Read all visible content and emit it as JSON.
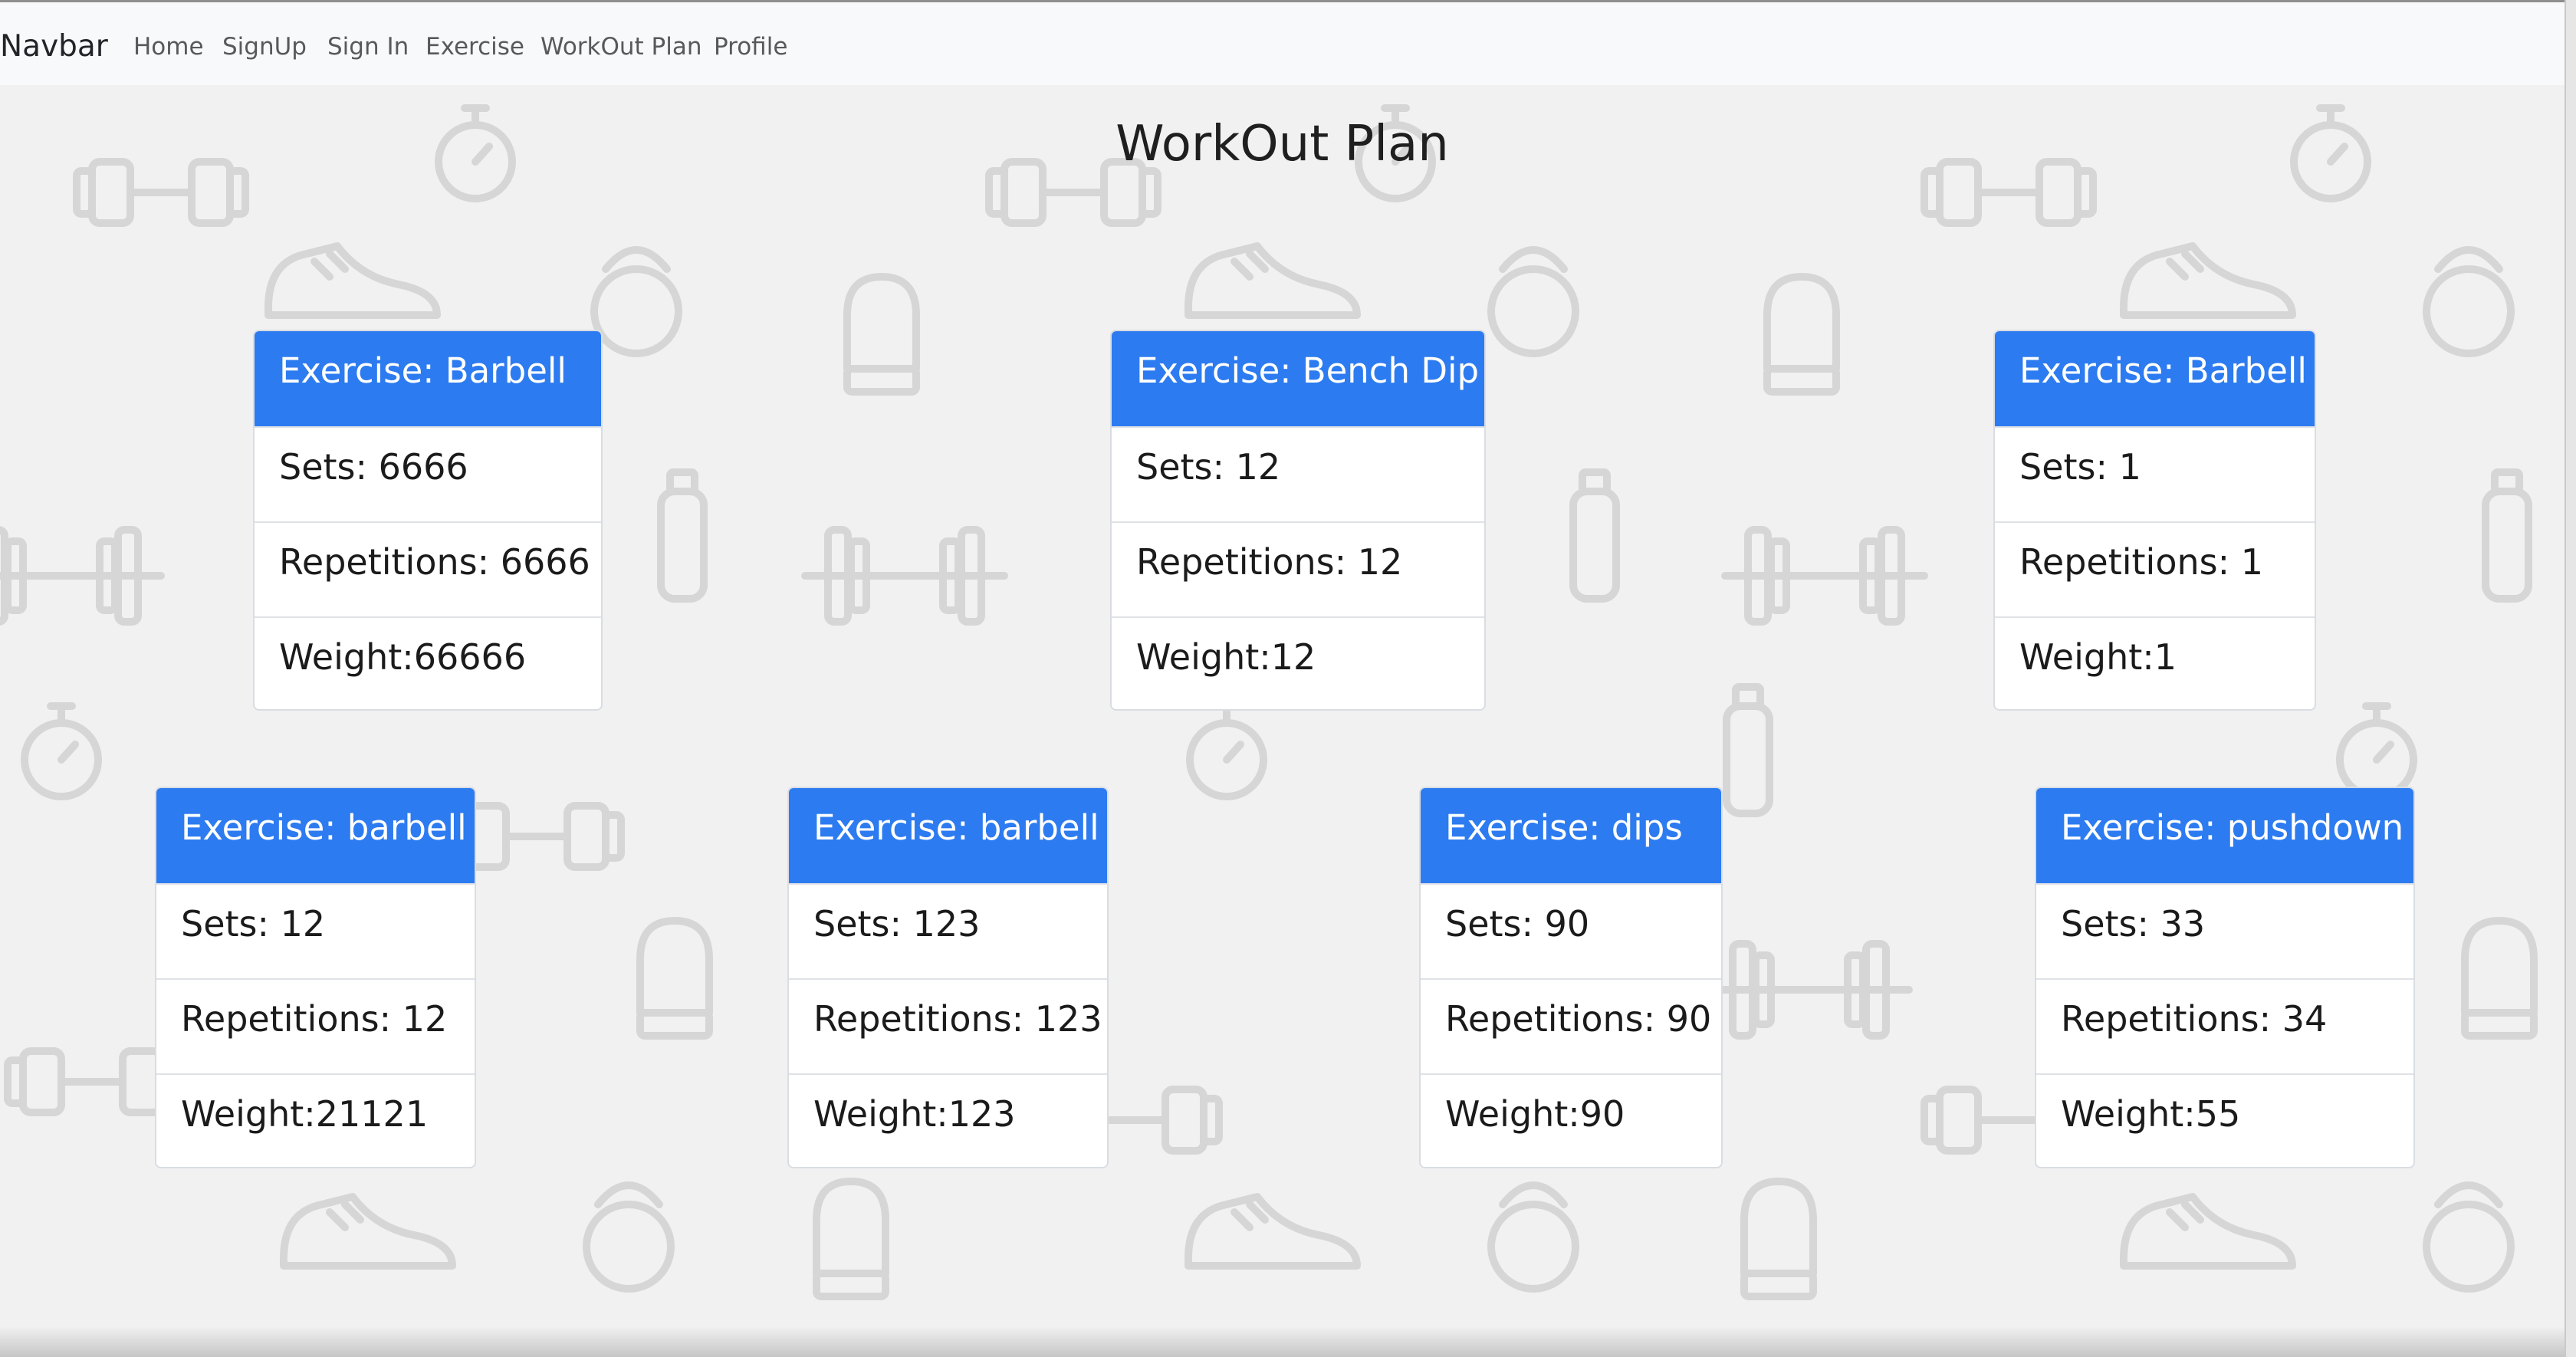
{
  "navbar": {
    "brand": "Navbar",
    "links": [
      "Home",
      "SignUp",
      "Sign In",
      "Exercise",
      "WorkOut Plan",
      "Profile"
    ]
  },
  "page": {
    "title": "WorkOut Plan"
  },
  "cards": [
    {
      "header": "Exercise: Barbell",
      "sets": "Sets: 6666",
      "reps": "Repetitions: 6666",
      "weight": "Weight:66666"
    },
    {
      "header": "Exercise: Bench Dip",
      "sets": "Sets: 12",
      "reps": "Repetitions: 12",
      "weight": "Weight:12"
    },
    {
      "header": "Exercise: Barbell",
      "sets": "Sets: 1",
      "reps": "Repetitions: 1",
      "weight": "Weight:1"
    },
    {
      "header": "Exercise: barbell",
      "sets": "Sets: 12",
      "reps": "Repetitions: 12",
      "weight": "Weight:21121"
    },
    {
      "header": "Exercise: barbell",
      "sets": "Sets: 123",
      "reps": "Repetitions: 123",
      "weight": "Weight:123"
    },
    {
      "header": "Exercise: dips",
      "sets": "Sets: 90",
      "reps": "Repetitions: 90",
      "weight": "Weight:90"
    },
    {
      "header": "Exercise: pushdown",
      "sets": "Sets: 33",
      "reps": "Repetitions: 34",
      "weight": "Weight:55"
    }
  ],
  "colors": {
    "card_header": "#2d7bf0",
    "navbar_bg": "#f8f9fa",
    "page_bg": "#f1f1f2",
    "doodle": "#d8d8d8"
  },
  "icons": [
    "dumbbell-icon",
    "stopwatch-icon",
    "sneaker-icon",
    "kettlebell-icon",
    "boxing-glove-icon",
    "water-bottle-icon",
    "jump-rope-icon"
  ]
}
